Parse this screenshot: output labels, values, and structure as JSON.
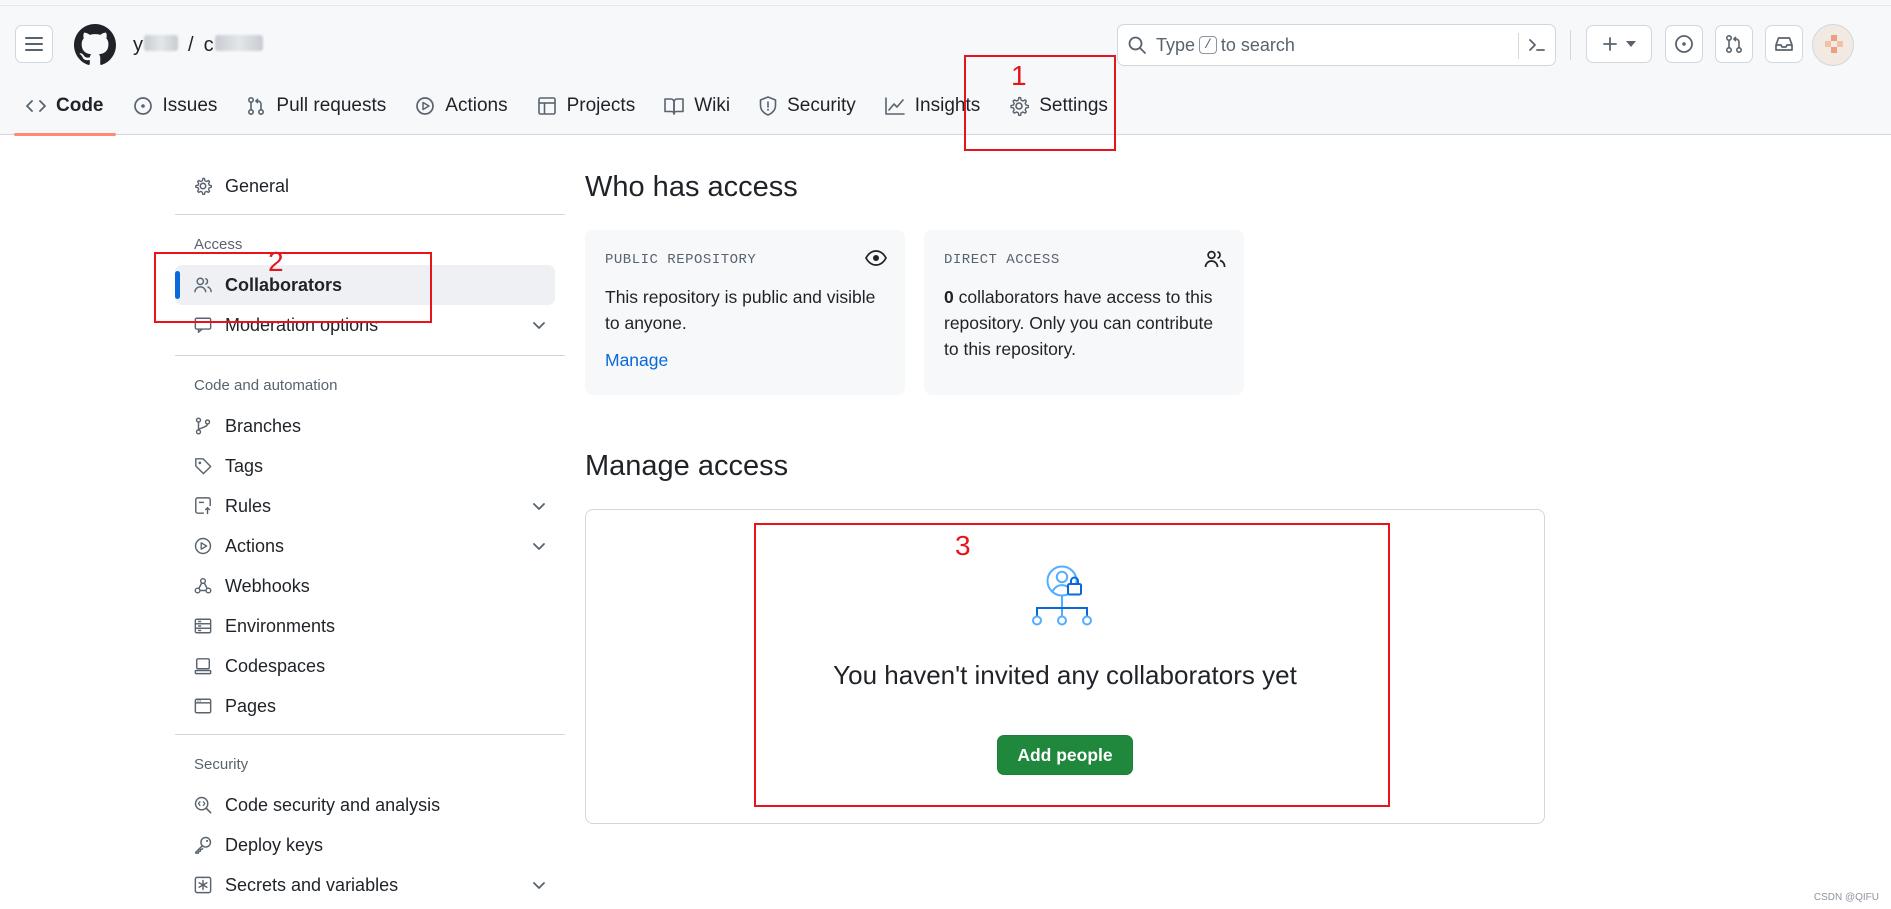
{
  "header": {
    "owner": "y",
    "separator": "/",
    "repo": "c",
    "search_prefix": "Type",
    "search_key": "/",
    "search_suffix": "to search"
  },
  "tabs": [
    {
      "label": "Code",
      "icon": "code-icon",
      "selected": true
    },
    {
      "label": "Issues",
      "icon": "issue-icon"
    },
    {
      "label": "Pull requests",
      "icon": "pull-request-icon"
    },
    {
      "label": "Actions",
      "icon": "play-icon"
    },
    {
      "label": "Projects",
      "icon": "table-icon"
    },
    {
      "label": "Wiki",
      "icon": "book-icon"
    },
    {
      "label": "Security",
      "icon": "shield-icon"
    },
    {
      "label": "Insights",
      "icon": "graph-icon"
    },
    {
      "label": "Settings",
      "icon": "gear-icon"
    }
  ],
  "sidebar": {
    "general": "General",
    "access_heading": "Access",
    "collaborators": "Collaborators",
    "moderation": "Moderation options",
    "code_heading": "Code and automation",
    "branches": "Branches",
    "tags": "Tags",
    "rules": "Rules",
    "actions": "Actions",
    "webhooks": "Webhooks",
    "environments": "Environments",
    "codespaces": "Codespaces",
    "pages": "Pages",
    "security_heading": "Security",
    "code_security": "Code security and analysis",
    "deploy_keys": "Deploy keys",
    "secrets": "Secrets and variables"
  },
  "main": {
    "who_title": "Who has access",
    "public_card": {
      "title": "PUBLIC REPOSITORY",
      "text": "This repository is public and visible to anyone.",
      "link": "Manage"
    },
    "direct_card": {
      "title": "DIRECT ACCESS",
      "count": "0",
      "text": " collaborators have access to this repository. Only you can contribute to this repository."
    },
    "manage_title": "Manage access",
    "empty_title": "You haven't invited any collaborators yet",
    "add_button": "Add people"
  },
  "annotations": {
    "one": "1",
    "two": "2",
    "three": "3",
    "color": "#e8141b"
  },
  "watermark": "CSDN @QIFU"
}
